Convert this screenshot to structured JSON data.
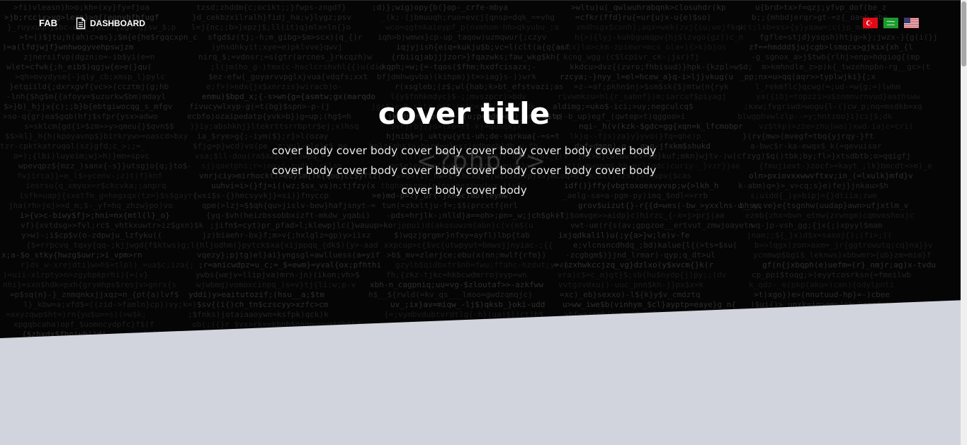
{
  "navbar": {
    "brand": "FAB",
    "dashboard_label": "DASHBOARD",
    "dashboard_icon": "document-icon",
    "flags": [
      {
        "name": "turkey-flag-icon",
        "colors": {
          "bg": "#e30a17",
          "fg": "#ffffff"
        }
      },
      {
        "name": "saudi-flag-icon",
        "colors": {
          "bg": "#1a9b2c",
          "fg": "#ffffff"
        }
      },
      {
        "name": "usa-flag-icon",
        "colors": {
          "bg": "#b22234",
          "fg": "#ffffff",
          "canton": "#3c3b6e"
        }
      }
    ]
  },
  "hero": {
    "background_color": "#050505",
    "watermark": "<?php ?>"
  },
  "cover": {
    "title": "cover title",
    "body": "cover body cover body cover body cover body cover body cover body cover body cover body cover body cover body cover body cover body cover body cover body"
  },
  "page": {
    "lower_background": "#d1d4dc"
  }
}
